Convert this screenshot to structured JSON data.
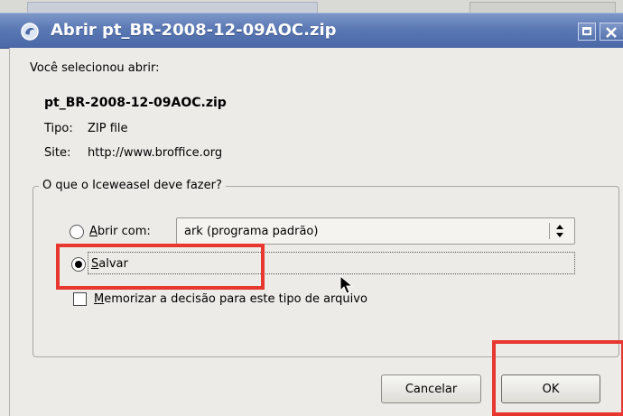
{
  "window": {
    "title": "Abrir pt_BR-2008-12-09AOC.zip"
  },
  "dialog": {
    "intro": "Você selecionou abrir:",
    "filename": "pt_BR-2008-12-09AOC.zip",
    "type_label": "Tipo:",
    "type_value": "ZIP file",
    "site_label": "Site:",
    "site_value": "http://www.broffice.org"
  },
  "action_group": {
    "legend": "O que o Iceweasel deve fazer?",
    "open_with": {
      "mnemonic": "A",
      "rest": "brir com:",
      "selected": false
    },
    "open_with_app": "ark (programa padrão)",
    "save": {
      "mnemonic": "S",
      "rest": "alvar",
      "selected": true
    },
    "remember": {
      "mnemonic": "M",
      "rest": "emorizar a decisão para este tipo de arquivo",
      "checked": false
    }
  },
  "buttons": {
    "cancel": "Cancelar",
    "ok": "OK"
  },
  "colors": {
    "titlebar": "#5a78b4",
    "highlight": "#e8372e",
    "dialog_bg": "#ecebe8"
  }
}
